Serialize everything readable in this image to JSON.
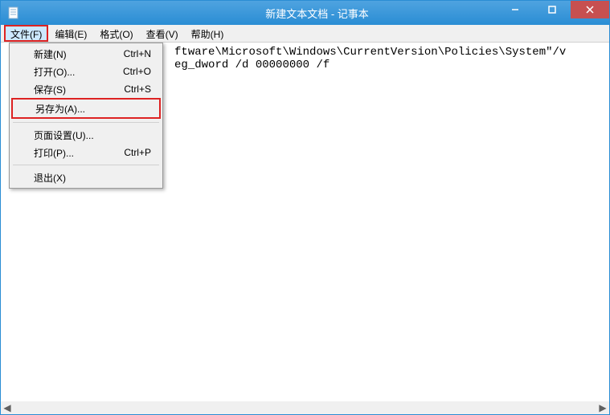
{
  "title": "新建文本文档 - 记事本",
  "menubar": {
    "file": "文件(F)",
    "edit": "编辑(E)",
    "format": "格式(O)",
    "view": "查看(V)",
    "help": "帮助(H)"
  },
  "dropdown": {
    "new": {
      "label": "新建(N)",
      "shortcut": "Ctrl+N"
    },
    "open": {
      "label": "打开(O)...",
      "shortcut": "Ctrl+O"
    },
    "save": {
      "label": "保存(S)",
      "shortcut": "Ctrl+S"
    },
    "saveas": {
      "label": "另存为(A)...",
      "shortcut": ""
    },
    "pagesetup": {
      "label": "页面设置(U)...",
      "shortcut": ""
    },
    "print": {
      "label": "打印(P)...",
      "shortcut": "Ctrl+P"
    },
    "exit": {
      "label": "退出(X)",
      "shortcut": ""
    }
  },
  "content": {
    "line1": "                         ftware\\Microsoft\\Windows\\CurrentVersion\\Policies\\System\"/v",
    "line2": "                         eg_dword /d 00000000 /f"
  }
}
